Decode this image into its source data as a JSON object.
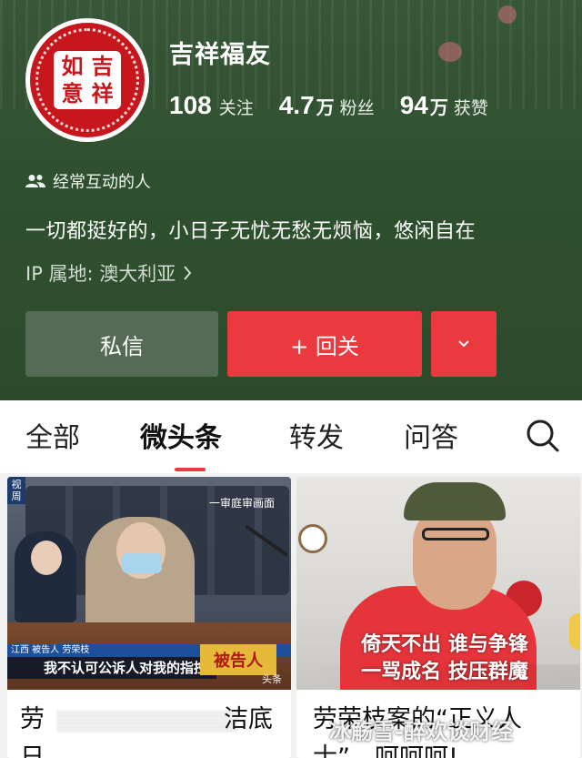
{
  "profile": {
    "avatar_text": [
      "如",
      "吉",
      "意",
      "祥"
    ],
    "username": "吉祥福友",
    "stats": [
      {
        "num": "108",
        "unit": "",
        "label": "关注"
      },
      {
        "num": "4.7",
        "unit": "万",
        "label": "粉丝"
      },
      {
        "num": "94",
        "unit": "万",
        "label": "获赞"
      }
    ],
    "interaction_label": "经常互动的人",
    "bio": "一切都挺好的，小日子无忧无愁无烦恼，悠闲自在",
    "ip_location": "IP 属地: 澳大利亚"
  },
  "actions": {
    "message_label": "私信",
    "follow_label": "+ 回关"
  },
  "tabs": [
    {
      "label": "全部",
      "active": false
    },
    {
      "label": "微头条",
      "active": true
    },
    {
      "label": "转发",
      "active": false
    },
    {
      "label": "问答",
      "active": false
    }
  ],
  "feed": {
    "left_card": {
      "corner_badge": "视周",
      "top_tag": "一审庭审画面",
      "lower_band": "江西 被告人 劳荣枝",
      "caption": "我不认可公诉人对我的指控",
      "defendant_sign": "被告人",
      "source": "头条",
      "title_start": "劳",
      "title_end": "洁底",
      "title_line2": "日"
    },
    "right_card": {
      "overlay_line1": "倚天不出 谁与争锋",
      "overlay_line2": "一骂成名 技压群魔",
      "title": "劳荣枝案的“正义人",
      "title_line2": "士”，呵呵呵!"
    }
  },
  "watermark": "冰觞雪-醉欢谈财经",
  "colors": {
    "header_bg": "#2f502f",
    "accent_red": "#ea3a3f",
    "message_btn": "#556b55"
  }
}
